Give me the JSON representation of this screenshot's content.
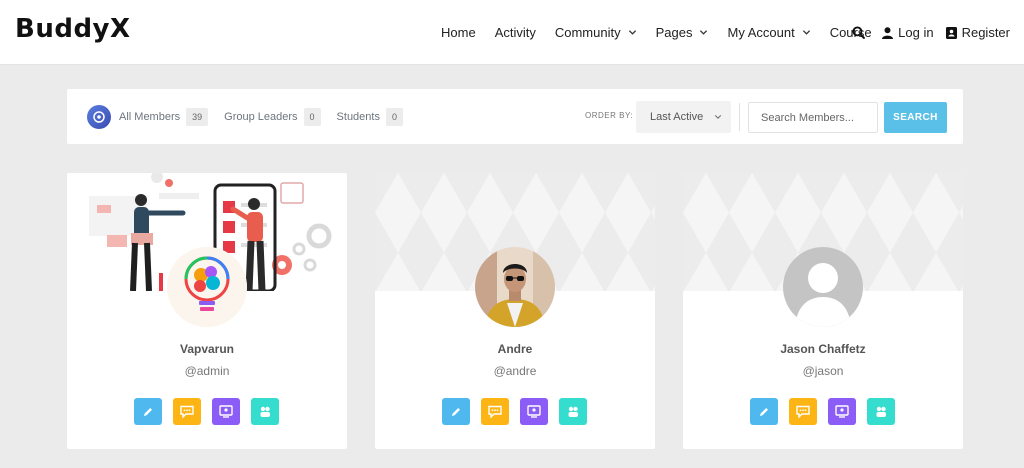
{
  "site": {
    "logo": "BuddyX"
  },
  "nav": {
    "items": [
      {
        "label": "Home",
        "dropdown": false
      },
      {
        "label": "Activity",
        "dropdown": false
      },
      {
        "label": "Community",
        "dropdown": true
      },
      {
        "label": "Pages",
        "dropdown": true
      },
      {
        "label": "My Account",
        "dropdown": true
      },
      {
        "label": "Course",
        "dropdown": false
      }
    ],
    "login_label": "Log in",
    "register_label": "Register"
  },
  "filters": {
    "tabs": [
      {
        "label": "All Members",
        "count": "39"
      },
      {
        "label": "Group Leaders",
        "count": "0"
      },
      {
        "label": "Students",
        "count": "0"
      }
    ],
    "order_by_label": "ORDER BY:",
    "order_by_value": "Last Active",
    "search_placeholder": "Search Members...",
    "search_button": "SEARCH"
  },
  "members": [
    {
      "name": "Vapvarun",
      "handle": "@admin",
      "cover": "illustration",
      "avatar": "lightbulb"
    },
    {
      "name": "Andre",
      "handle": "@andre",
      "cover": "pattern",
      "avatar": "photo"
    },
    {
      "name": "Jason Chaffetz",
      "handle": "@jason",
      "cover": "pattern",
      "avatar": "default"
    }
  ],
  "colors": {
    "accent": "#5bc0e7",
    "edit": "#4fb8ee",
    "message": "#fdb515",
    "view": "#8b5cf6",
    "group": "#35ddcf"
  }
}
